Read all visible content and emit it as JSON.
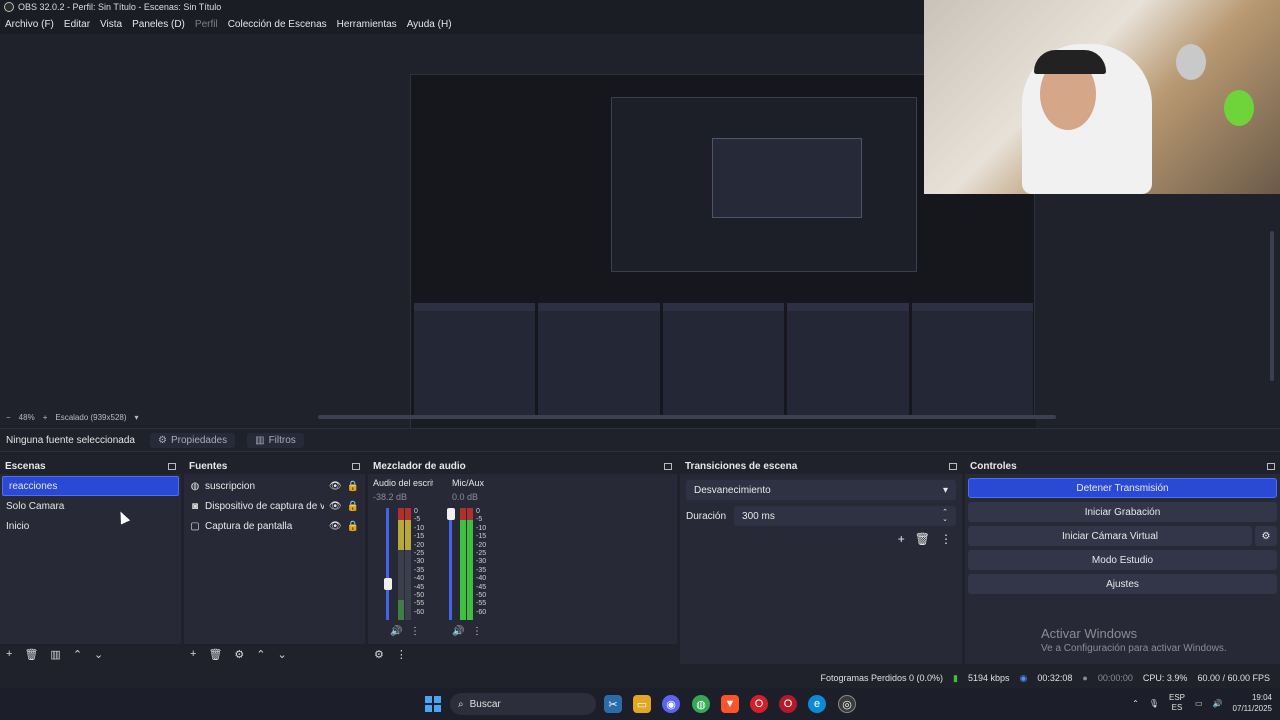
{
  "window": {
    "title": "OBS 32.0.2 - Perfil: Sin Título - Escenas: Sin Título"
  },
  "menu": [
    {
      "label": "Archivo (F)",
      "disabled": false
    },
    {
      "label": "Editar",
      "disabled": false
    },
    {
      "label": "Vista",
      "disabled": false
    },
    {
      "label": "Paneles (D)",
      "disabled": false
    },
    {
      "label": "Perfil",
      "disabled": true
    },
    {
      "label": "Colección de Escenas",
      "disabled": false
    },
    {
      "label": "Herramientas",
      "disabled": false
    },
    {
      "label": "Ayuda (H)",
      "disabled": false
    }
  ],
  "preview": {
    "zoom": "48%",
    "scaling": "Escalado (939x528)"
  },
  "source_toolbar": {
    "no_selection": "Ninguna fuente seleccionada",
    "properties": "Propiedades",
    "filters": "Filtros"
  },
  "scenes": {
    "title": "Escenas",
    "items": [
      {
        "label": "reacciones",
        "selected": true
      },
      {
        "label": "Solo Camara",
        "selected": false
      },
      {
        "label": "Inicio",
        "selected": false
      }
    ]
  },
  "sources": {
    "title": "Fuentes",
    "items": [
      {
        "label": "suscripcion",
        "icon": "globe-icon"
      },
      {
        "label": "Dispositivo de captura de video",
        "icon": "camera-icon"
      },
      {
        "label": "Captura de pantalla",
        "icon": "monitor-icon"
      }
    ]
  },
  "mixer": {
    "title": "Mezclador de audio",
    "channels": [
      {
        "name": "Audio del escritorio",
        "db": "-38.2 dB"
      },
      {
        "name": "Mic/Aux",
        "db": "0.0 dB"
      }
    ],
    "scale": [
      "0",
      "-5",
      "-10",
      "-15",
      "-20",
      "-25",
      "-30",
      "-35",
      "-40",
      "-45",
      "-50",
      "-55",
      "-60"
    ]
  },
  "transitions": {
    "title": "Transiciones de escena",
    "selected": "Desvanecimiento",
    "duration_label": "Duración",
    "duration_value": "300 ms"
  },
  "controls": {
    "title": "Controles",
    "stop_stream": "Detener Transmisión",
    "start_record": "Iniciar Grabación",
    "virtual_cam": "Iniciar Cámara Virtual",
    "studio_mode": "Modo Estudio",
    "settings": "Ajustes"
  },
  "watermark": {
    "line1": "Activar Windows",
    "line2": "Ve a Configuración para activar Windows."
  },
  "status": {
    "dropped": "Fotogramas Perdidos 0 (0.0%)",
    "bitrate": "5194 kbps",
    "stream_time": "00:32:08",
    "rec_time": "00:00:00",
    "cpu": "CPU: 3.9%",
    "fps": "60.00 / 60.00 FPS"
  },
  "taskbar": {
    "search": "Buscar",
    "lang_top": "ESP",
    "lang_bottom": "ES",
    "time": "19:04",
    "date": "07/11/2025"
  }
}
